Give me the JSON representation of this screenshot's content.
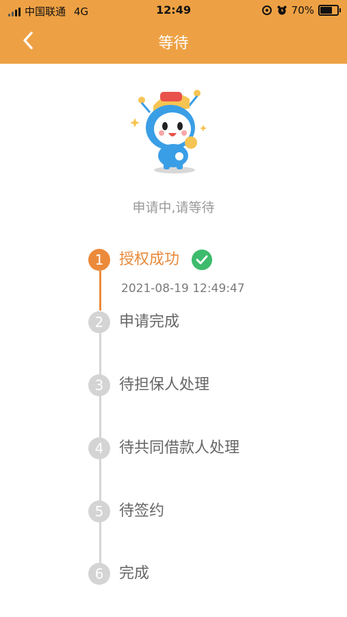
{
  "status_bar": {
    "carrier": "中国联通",
    "network": "4G",
    "time": "12:49",
    "battery": "70%"
  },
  "nav": {
    "title": "等待"
  },
  "status_text": "申请中,请等待",
  "steps": [
    {
      "number": "1",
      "label": "授权成功",
      "time": "2021-08-19 12:49:47"
    },
    {
      "number": "2",
      "label": "申请完成"
    },
    {
      "number": "3",
      "label": "待担保人处理"
    },
    {
      "number": "4",
      "label": "待共同借款人处理"
    },
    {
      "number": "5",
      "label": "待签约"
    },
    {
      "number": "6",
      "label": "完成"
    }
  ],
  "colors": {
    "header": "#eea144",
    "active": "#ec8a3b",
    "inactive": "#d4d4d4",
    "success": "#3dbb6c"
  },
  "icons": [
    "signal-icon",
    "location-icon",
    "alarm-icon",
    "battery-icon",
    "back-icon",
    "mascot-icon",
    "check-icon"
  ]
}
